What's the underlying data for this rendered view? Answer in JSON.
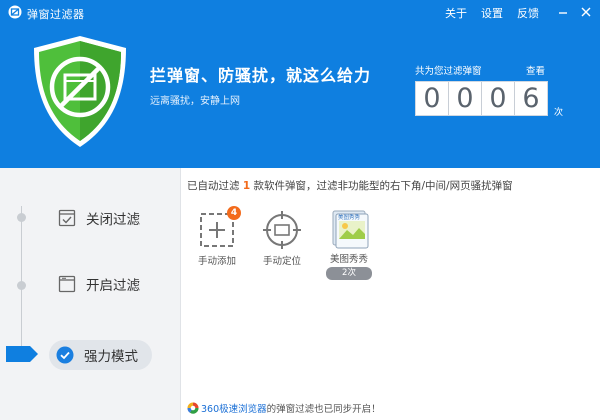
{
  "window": {
    "title": "弹窗过滤器",
    "menu": [
      "关于",
      "设置",
      "反馈"
    ]
  },
  "hero": {
    "headline": "拦弹窗、防骚扰，就这么给力",
    "subline": "远离骚扰，安静上网",
    "counter_caption": "共为您过滤弹窗",
    "view_link": "查看",
    "digits": [
      "0",
      "0",
      "0",
      "6"
    ],
    "unit": "次"
  },
  "sidebar": {
    "items": [
      {
        "label": "关闭过滤"
      },
      {
        "label": "开启过滤"
      },
      {
        "label": "强力模式"
      }
    ]
  },
  "main": {
    "notice_prefix": "已自动过滤",
    "notice_count": "1",
    "notice_suffix": "款软件弹窗，过滤非功能型的右下角/中间/网页骚扰弹窗",
    "tiles": [
      {
        "label": "手动添加",
        "badge": "4"
      },
      {
        "label": "手动定位"
      },
      {
        "label": "美图秀秀",
        "count": "2次",
        "logo_text": "美图秀秀"
      }
    ],
    "footer_link": "360极速浏览器",
    "footer_text": "的弹窗过滤也已同步开启！"
  },
  "colors": {
    "header_blue": "#0f7fe0",
    "shield_green": "#45b635",
    "accent_orange": "#f26a1b",
    "link_blue": "#1b70d6"
  }
}
